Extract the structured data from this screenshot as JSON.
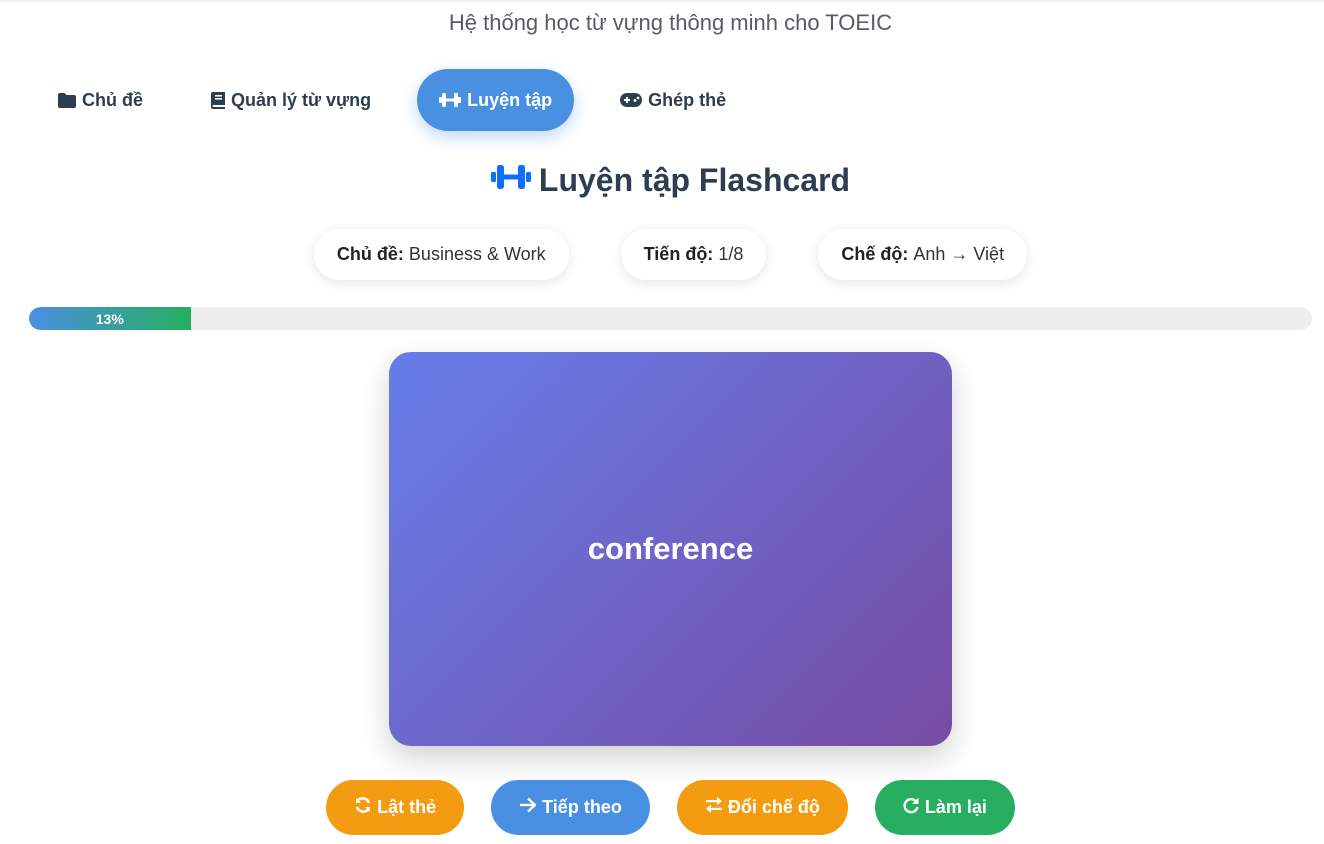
{
  "header": {
    "subtitle": "Hệ thống học từ vựng thông minh cho TOEIC"
  },
  "nav": {
    "tabs": [
      {
        "label": "Chủ đề",
        "icon": "folder-icon"
      },
      {
        "label": "Quản lý từ vựng",
        "icon": "book-icon"
      },
      {
        "label": "Luyện tập",
        "icon": "dumbbell-icon",
        "active": true
      },
      {
        "label": "Ghép thẻ",
        "icon": "gamepad-icon"
      }
    ]
  },
  "practice": {
    "title": "Luyện tập Flashcard",
    "title_icon": "dumbbell-icon",
    "topic_label": "Chủ đề:",
    "topic_value": "Business & Work",
    "progress_label": "Tiến độ:",
    "progress_value": "1/8",
    "mode_label": "Chế độ:",
    "mode_value": "Anh → Việt",
    "progress_percent": 13,
    "progress_text": "13%"
  },
  "flashcard": {
    "word": "conference"
  },
  "actions": {
    "flip": "Lật thẻ",
    "next": "Tiếp theo",
    "switch_mode": "Đổi chế độ",
    "reset": "Làm lại"
  },
  "colors": {
    "accent": "#4a90e2",
    "orange": "#f39c12",
    "green": "#27ae60",
    "card_start": "#667eea",
    "card_end": "#764ba2",
    "icon_blue": "#0d6efd"
  }
}
